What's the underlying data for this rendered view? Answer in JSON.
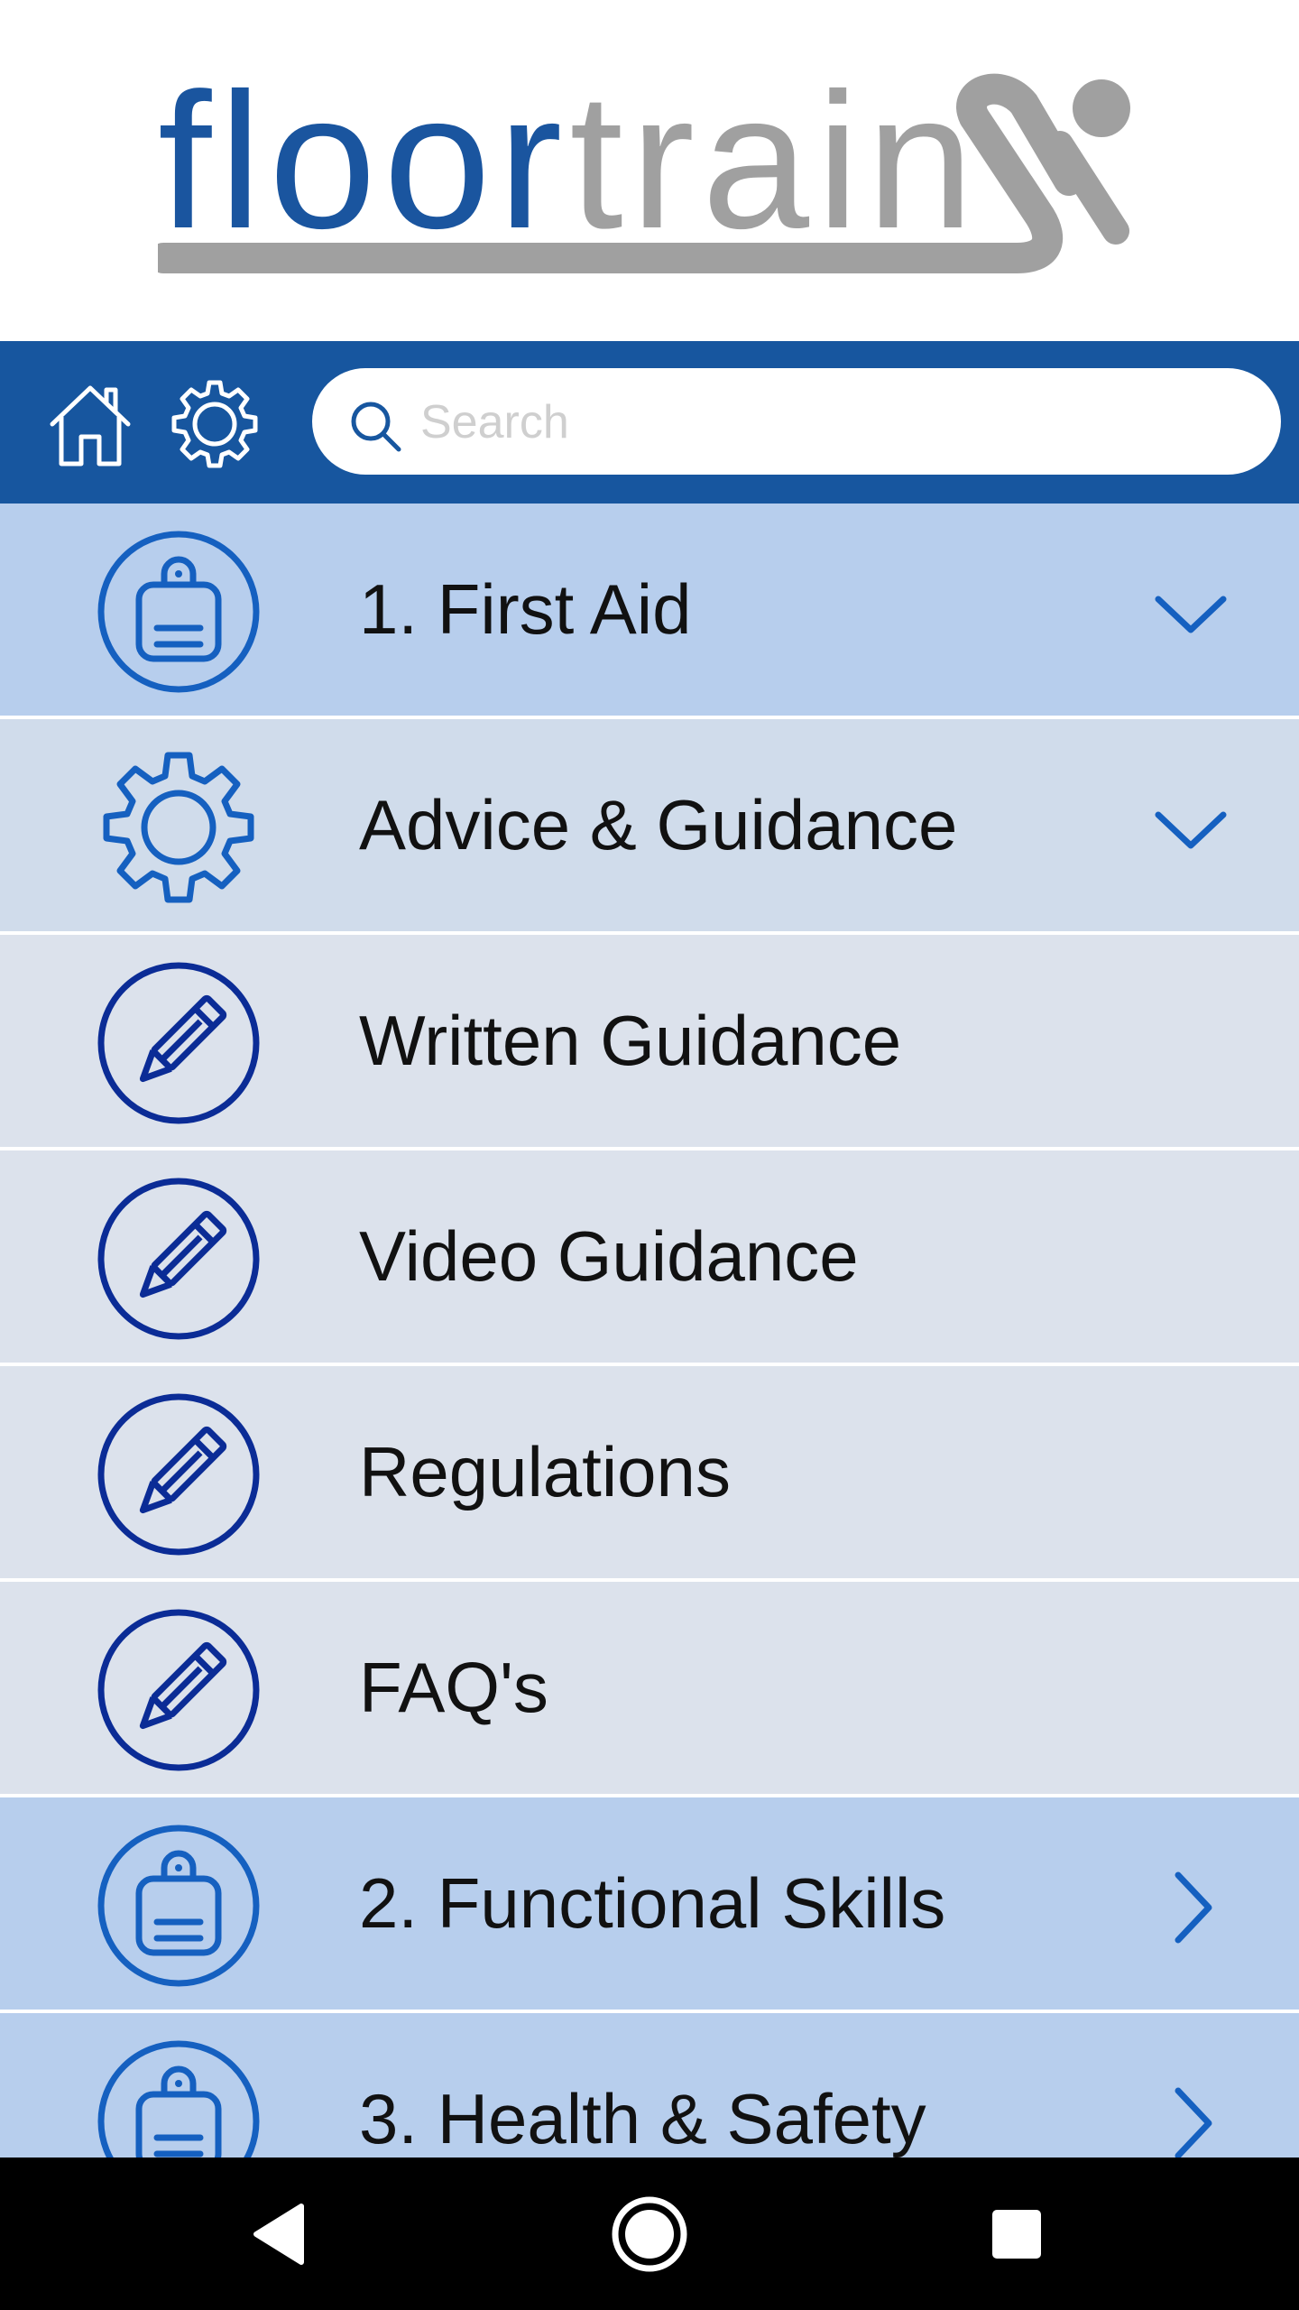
{
  "brand": {
    "word_primary": "floor",
    "word_secondary": "train",
    "color_primary": "#1a559f",
    "color_secondary": "#a0a0a0"
  },
  "toolbar": {
    "background": "#17569f",
    "home_icon": "home-icon",
    "settings_icon": "gear-icon",
    "search": {
      "placeholder": "Search",
      "value": "",
      "icon": "search-icon"
    }
  },
  "menu": [
    {
      "label": "1. First Aid",
      "icon": "clipboard-icon",
      "indicator": "chevron-down-icon",
      "kind": "section"
    },
    {
      "label": "Advice & Guidance",
      "icon": "gear-icon",
      "indicator": "chevron-down-icon",
      "kind": "subsection"
    },
    {
      "label": "Written Guidance",
      "icon": "pencil-icon",
      "indicator": "",
      "kind": "item"
    },
    {
      "label": "Video Guidance",
      "icon": "pencil-icon",
      "indicator": "",
      "kind": "item"
    },
    {
      "label": "Regulations",
      "icon": "pencil-icon",
      "indicator": "",
      "kind": "item"
    },
    {
      "label": "FAQ's",
      "icon": "pencil-icon",
      "indicator": "",
      "kind": "item"
    },
    {
      "label": "2. Functional Skills",
      "icon": "clipboard-icon",
      "indicator": "chevron-right-icon",
      "kind": "section"
    },
    {
      "label": "3. Health & Safety",
      "icon": "clipboard-icon",
      "indicator": "chevron-right-icon",
      "kind": "section"
    }
  ],
  "colors": {
    "section_bg": "#b7ceed",
    "subsection_bg": "#d0dceb",
    "item_bg": "#dce2ec",
    "icon_blue": "#1560c0",
    "icon_navy": "#0b2c96"
  },
  "navbar": {
    "back": "back-triangle-icon",
    "home": "home-circle-icon",
    "recents": "recents-square-icon"
  }
}
